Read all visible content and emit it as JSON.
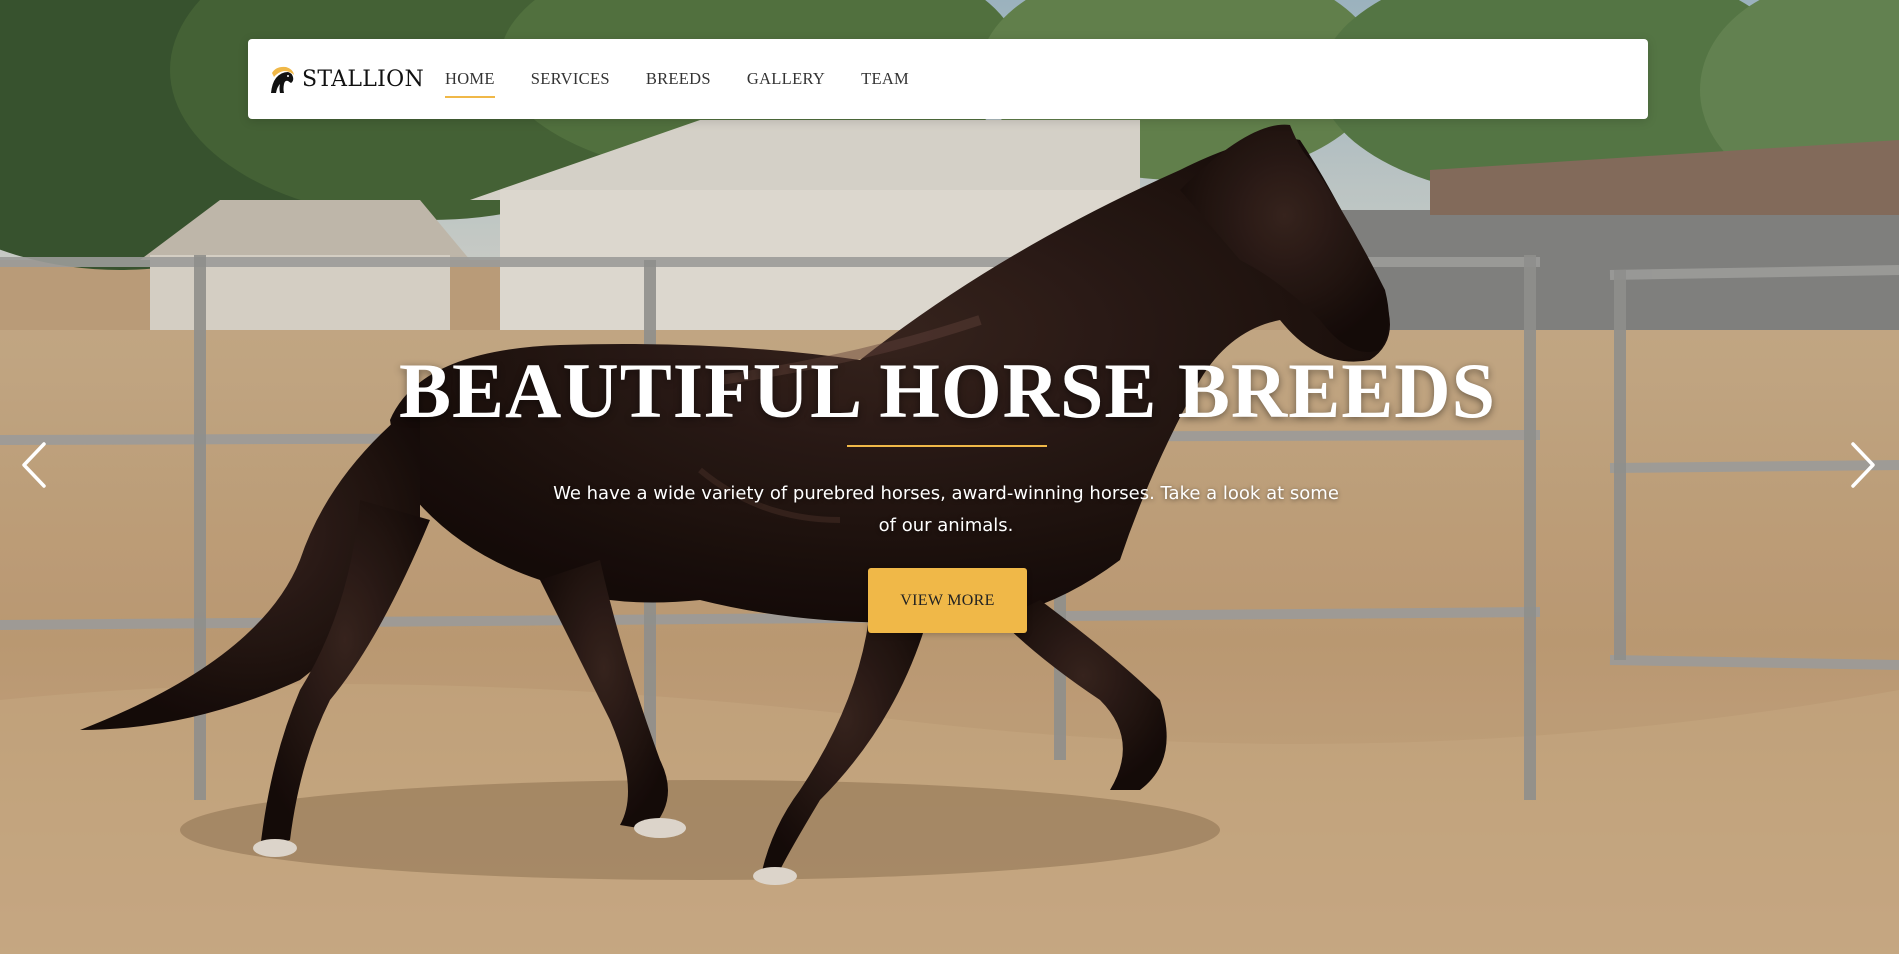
{
  "brand": {
    "name": "STALLION",
    "logo_icon": "horse-head-logo-icon",
    "accent_color": "#f0b848"
  },
  "nav": {
    "items": [
      {
        "label": "HOME",
        "active": true
      },
      {
        "label": "SERVICES",
        "active": false
      },
      {
        "label": "BREEDS",
        "active": false
      },
      {
        "label": "GALLERY",
        "active": false
      },
      {
        "label": "TEAM",
        "active": false
      }
    ]
  },
  "hero": {
    "title": "BEAUTIFUL HORSE BREEDS",
    "subtitle": "We have a wide variety of purebred horses, award-winning horses. Take a look at some of our animals.",
    "cta_label": "VIEW MORE",
    "background": "photo of a dark brown horse galloping in a sandy paddock",
    "prev_icon": "chevron-left-icon",
    "next_icon": "chevron-right-icon"
  }
}
